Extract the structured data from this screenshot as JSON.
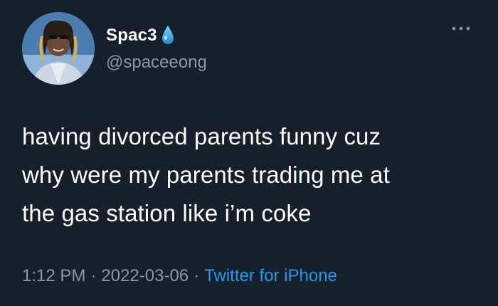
{
  "user": {
    "display_name": "Spac3",
    "handle": "@spaceeong",
    "badge_icon": "water-drop-icon"
  },
  "tweet": {
    "lines": [
      "having divorced parents funny cuz",
      "why were my parents trading me at",
      "the gas station like i’m coke"
    ]
  },
  "meta": {
    "time": "1:12 PM",
    "separator": "·",
    "date": "2022-03-06",
    "source": "Twitter for iPhone"
  },
  "colors": {
    "background": "#15202b",
    "text": "#ffffff",
    "secondary": "#8899a6",
    "link": "#1d9bf0"
  },
  "icons": {
    "more": "more-horizontal-icon"
  }
}
